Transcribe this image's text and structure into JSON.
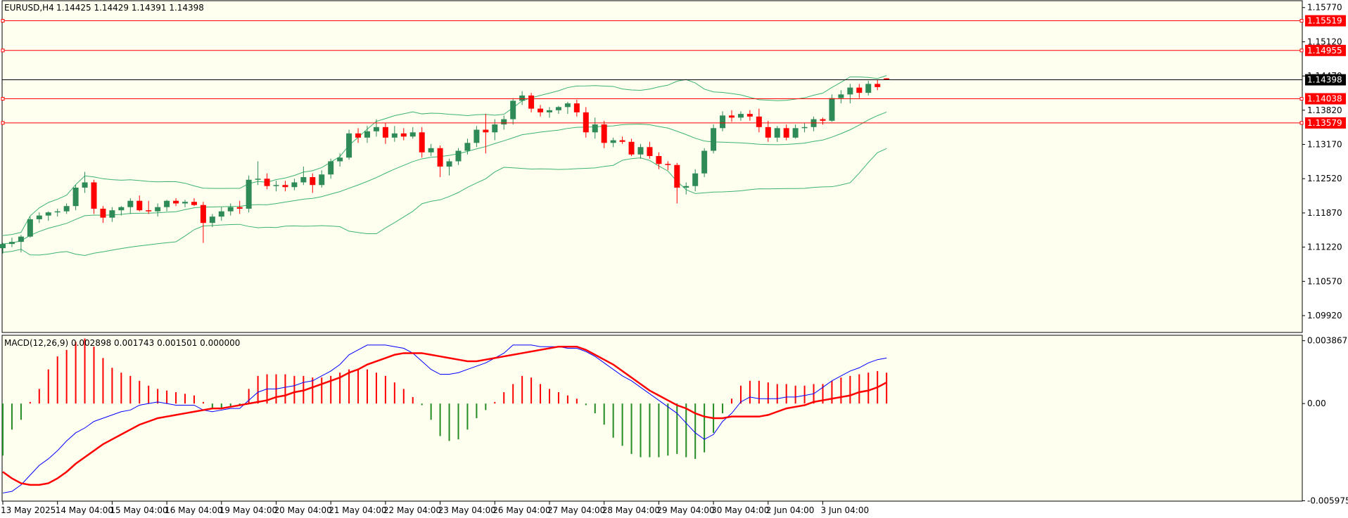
{
  "header": {
    "symbol": "EURUSD,H4",
    "ohlc": "1.14425 1.14429 1.14391 1.14398"
  },
  "macd_header": "MACD(12,26,9) 0.002898 0.001743 0.001501 0.000000",
  "colors": {
    "bg": "#fffff0",
    "bull": "#2e8b57",
    "bear": "#ff0000",
    "bands": "#3cb371",
    "macd": "#0000ff",
    "signal": "#ff0000",
    "level": "#ff0000",
    "bid": "#000000"
  },
  "chart_data": [
    {
      "type": "candlestick",
      "title": "EURUSD,H4",
      "ylim": [
        1.096,
        1.159
      ],
      "y_ticks": [
        "1.15770",
        "1.15120",
        "1.14470",
        "1.13820",
        "1.13170",
        "1.12520",
        "1.11870",
        "1.11220",
        "1.10570",
        "1.09920"
      ],
      "x_ticks": [
        "13 May 2025",
        "14 May 04:00",
        "15 May 04:00",
        "16 May 04:00",
        "19 May 04:00",
        "20 May 04:00",
        "21 May 04:00",
        "22 May 04:00",
        "23 May 04:00",
        "26 May 04:00",
        "27 May 04:00",
        "28 May 04:00",
        "29 May 04:00",
        "30 May 04:00",
        "2 Jun 04:00",
        "3 Jun 04:00"
      ],
      "price_labels": [
        {
          "text": "1.15519",
          "value": 1.15519,
          "style": "level"
        },
        {
          "text": "1.14955",
          "value": 1.14955,
          "style": "level"
        },
        {
          "text": "1.14398",
          "value": 1.14398,
          "style": "bid"
        },
        {
          "text": "1.14038",
          "value": 1.14038,
          "style": "level"
        },
        {
          "text": "1.13579",
          "value": 1.13579,
          "style": "level"
        }
      ],
      "ohlc": [
        [
          1.112,
          1.113,
          1.111,
          1.1128
        ],
        [
          1.1128,
          1.114,
          1.1122,
          1.1132
        ],
        [
          1.1132,
          1.1145,
          1.1112,
          1.1142
        ],
        [
          1.1142,
          1.118,
          1.114,
          1.1175
        ],
        [
          1.1175,
          1.1188,
          1.1168,
          1.1182
        ],
        [
          1.1182,
          1.119,
          1.1172,
          1.1188
        ],
        [
          1.1188,
          1.1195,
          1.118,
          1.119
        ],
        [
          1.119,
          1.1205,
          1.1185,
          1.12
        ],
        [
          1.12,
          1.124,
          1.1192,
          1.1235
        ],
        [
          1.1235,
          1.1265,
          1.1225,
          1.1245
        ],
        [
          1.1245,
          1.125,
          1.1185,
          1.1195
        ],
        [
          1.1195,
          1.12,
          1.1168,
          1.1178
        ],
        [
          1.1178,
          1.1198,
          1.117,
          1.1192
        ],
        [
          1.1192,
          1.12,
          1.1182,
          1.1198
        ],
        [
          1.1198,
          1.1215,
          1.1185,
          1.121
        ],
        [
          1.121,
          1.122,
          1.119,
          1.1192
        ],
        [
          1.1192,
          1.121,
          1.1185,
          1.119
        ],
        [
          1.119,
          1.1205,
          1.118,
          1.1198
        ],
        [
          1.1198,
          1.1212,
          1.119,
          1.121
        ],
        [
          1.121,
          1.1215,
          1.12,
          1.1205
        ],
        [
          1.1205,
          1.1212,
          1.1198,
          1.1208
        ],
        [
          1.1208,
          1.1215,
          1.12,
          1.1202
        ],
        [
          1.1202,
          1.1208,
          1.113,
          1.1168
        ],
        [
          1.1168,
          1.1185,
          1.116,
          1.118
        ],
        [
          1.118,
          1.1198,
          1.1172,
          1.119
        ],
        [
          1.119,
          1.1205,
          1.1182,
          1.1198
        ],
        [
          1.1198,
          1.121,
          1.1185,
          1.1195
        ],
        [
          1.1195,
          1.1258,
          1.1188,
          1.125
        ],
        [
          1.125,
          1.1285,
          1.124,
          1.1252
        ],
        [
          1.1252,
          1.1262,
          1.1232,
          1.1238
        ],
        [
          1.1238,
          1.1248,
          1.1228,
          1.124
        ],
        [
          1.124,
          1.1248,
          1.1228,
          1.1236
        ],
        [
          1.1236,
          1.1252,
          1.123,
          1.1245
        ],
        [
          1.1245,
          1.1275,
          1.124,
          1.1255
        ],
        [
          1.1255,
          1.1262,
          1.1225,
          1.124
        ],
        [
          1.124,
          1.1268,
          1.1235,
          1.126
        ],
        [
          1.126,
          1.129,
          1.1252,
          1.1285
        ],
        [
          1.1285,
          1.13,
          1.1275,
          1.1292
        ],
        [
          1.1292,
          1.1345,
          1.1288,
          1.1338
        ],
        [
          1.1338,
          1.1348,
          1.132,
          1.133
        ],
        [
          1.133,
          1.1352,
          1.132,
          1.1342
        ],
        [
          1.1342,
          1.1365,
          1.1332,
          1.135
        ],
        [
          1.135,
          1.1358,
          1.1318,
          1.133
        ],
        [
          1.133,
          1.1352,
          1.1322,
          1.1338
        ],
        [
          1.1338,
          1.1348,
          1.1325,
          1.1332
        ],
        [
          1.1332,
          1.135,
          1.1328,
          1.134
        ],
        [
          1.134,
          1.135,
          1.1292,
          1.1302
        ],
        [
          1.1302,
          1.1318,
          1.1295,
          1.131
        ],
        [
          1.131,
          1.1315,
          1.1255,
          1.1275
        ],
        [
          1.1275,
          1.129,
          1.1258,
          1.1285
        ],
        [
          1.1285,
          1.131,
          1.1278,
          1.1305
        ],
        [
          1.1305,
          1.1328,
          1.1298,
          1.132
        ],
        [
          1.132,
          1.1352,
          1.1312,
          1.1345
        ],
        [
          1.1345,
          1.1375,
          1.13,
          1.134
        ],
        [
          1.134,
          1.1365,
          1.1325,
          1.1355
        ],
        [
          1.1355,
          1.1372,
          1.1345,
          1.1365
        ],
        [
          1.1365,
          1.1405,
          1.1355,
          1.14
        ],
        [
          1.14,
          1.1418,
          1.1392,
          1.141
        ],
        [
          1.141,
          1.1415,
          1.1378,
          1.1385
        ],
        [
          1.1385,
          1.1392,
          1.137,
          1.1378
        ],
        [
          1.1378,
          1.1388,
          1.1368,
          1.1382
        ],
        [
          1.1382,
          1.139,
          1.1375,
          1.1388
        ],
        [
          1.1388,
          1.1398,
          1.1375,
          1.1395
        ],
        [
          1.1395,
          1.1402,
          1.137,
          1.1378
        ],
        [
          1.1378,
          1.1388,
          1.133,
          1.134
        ],
        [
          1.134,
          1.1368,
          1.1328,
          1.1355
        ],
        [
          1.1355,
          1.1362,
          1.131,
          1.132
        ],
        [
          1.132,
          1.133,
          1.1312,
          1.1325
        ],
        [
          1.1325,
          1.1332,
          1.1318,
          1.1322
        ],
        [
          1.1322,
          1.1328,
          1.1295,
          1.1298
        ],
        [
          1.1298,
          1.1318,
          1.129,
          1.1312
        ],
        [
          1.1312,
          1.1322,
          1.129,
          1.1295
        ],
        [
          1.1295,
          1.1302,
          1.127,
          1.128
        ],
        [
          1.128,
          1.1285,
          1.1268,
          1.1278
        ],
        [
          1.1278,
          1.1282,
          1.1205,
          1.1235
        ],
        [
          1.1235,
          1.1245,
          1.1222,
          1.1238
        ],
        [
          1.1238,
          1.127,
          1.1228,
          1.1262
        ],
        [
          1.1262,
          1.131,
          1.1255,
          1.1305
        ],
        [
          1.1305,
          1.1355,
          1.13,
          1.1348
        ],
        [
          1.1348,
          1.138,
          1.1342,
          1.1372
        ],
        [
          1.1372,
          1.1382,
          1.136,
          1.1368
        ],
        [
          1.1368,
          1.138,
          1.1362,
          1.1375
        ],
        [
          1.1375,
          1.1382,
          1.1362,
          1.137
        ],
        [
          1.137,
          1.1385,
          1.134,
          1.135
        ],
        [
          1.135,
          1.1362,
          1.1322,
          1.133
        ],
        [
          1.133,
          1.1352,
          1.1322,
          1.1348
        ],
        [
          1.1348,
          1.1355,
          1.1325,
          1.133
        ],
        [
          1.133,
          1.1355,
          1.1328,
          1.1348
        ],
        [
          1.1348,
          1.1358,
          1.134,
          1.135
        ],
        [
          1.135,
          1.137,
          1.1342,
          1.1365
        ],
        [
          1.1365,
          1.1368,
          1.1355,
          1.1362
        ],
        [
          1.1362,
          1.1412,
          1.136,
          1.1405
        ],
        [
          1.1405,
          1.142,
          1.1395,
          1.1412
        ],
        [
          1.1412,
          1.1432,
          1.1395,
          1.1425
        ],
        [
          1.1425,
          1.1432,
          1.1405,
          1.1415
        ],
        [
          1.1415,
          1.1438,
          1.141,
          1.1432
        ],
        [
          1.1432,
          1.144,
          1.142,
          1.1426
        ],
        [
          1.14425,
          1.14429,
          1.14391,
          1.14398
        ]
      ],
      "bollinger": {
        "period": 20,
        "upper_visible": "from start",
        "middle_visible": "from start",
        "lower_visible": "from start"
      }
    },
    {
      "type": "bar+line",
      "title": "MACD(12,26,9) 0.002898 0.001743 0.001501 0.000000",
      "ylim": [
        -0.006,
        0.0042
      ],
      "y_ticks": [
        "0.003867",
        "0.00",
        "-0.005975"
      ],
      "series": [
        {
          "name": "histogram",
          "values": [
            -0.0032,
            -0.0016,
            -0.001,
            0.0001,
            0.0009,
            0.0021,
            0.0029,
            0.0033,
            0.0038,
            0.004,
            0.0035,
            0.0028,
            0.0022,
            0.0019,
            0.0017,
            0.0014,
            0.0011,
            0.0009,
            0.0008,
            0.0007,
            0.0006,
            0.0005,
            0.0001,
            -0.0003,
            -0.0003,
            -0.0002,
            -0.0001,
            0.0009,
            0.0017,
            0.0018,
            0.0018,
            0.0018,
            0.0017,
            0.0017,
            0.0016,
            0.0016,
            0.0017,
            0.0019,
            0.0021,
            0.0021,
            0.0021,
            0.0019,
            0.0017,
            0.0013,
            0.0009,
            0.0004,
            -0.0001,
            -0.001,
            -0.002,
            -0.0023,
            -0.0022,
            -0.0016,
            -0.0009,
            -0.0004,
            0.0001,
            0.0007,
            0.0012,
            0.0017,
            0.0016,
            0.0012,
            0.0009,
            0.0007,
            0.0005,
            0.0003,
            -0.0001,
            -0.0006,
            -0.0013,
            -0.0021,
            -0.0026,
            -0.0031,
            -0.0033,
            -0.0033,
            -0.0033,
            -0.0032,
            -0.0031,
            -0.0033,
            -0.0034,
            -0.003,
            -0.0018,
            -0.0006,
            0.0003,
            0.0011,
            0.0014,
            0.0014,
            0.0013,
            0.0012,
            0.0012,
            0.0011,
            0.0011,
            0.0012,
            0.0012,
            0.0014,
            0.0016,
            0.0017,
            0.0018,
            0.0019,
            0.002,
            0.0019
          ]
        },
        {
          "name": "macd",
          "values": [
            -0.0055,
            -0.0054,
            -0.005,
            -0.0044,
            -0.0038,
            -0.0034,
            -0.0029,
            -0.0023,
            -0.0018,
            -0.0015,
            -0.0011,
            -0.0009,
            -0.0007,
            -0.0005,
            -0.0004,
            -0.0001,
            0.0,
            0.0001,
            0.0,
            -0.0001,
            -0.0001,
            -0.0001,
            -0.0004,
            -0.0005,
            -0.0004,
            -0.0003,
            -0.0003,
            0.0002,
            0.0007,
            0.0009,
            0.0009,
            0.001,
            0.0011,
            0.0013,
            0.0014,
            0.0017,
            0.002,
            0.0024,
            0.003,
            0.0033,
            0.0036,
            0.0036,
            0.0036,
            0.0035,
            0.0034,
            0.0031,
            0.0026,
            0.0021,
            0.0018,
            0.0018,
            0.0019,
            0.0021,
            0.0023,
            0.0025,
            0.0028,
            0.0031,
            0.0036,
            0.0036,
            0.0036,
            0.0035,
            0.0035,
            0.0035,
            0.0034,
            0.0034,
            0.0032,
            0.0029,
            0.0025,
            0.0021,
            0.0017,
            0.0014,
            0.001,
            0.0006,
            0.0002,
            -0.0002,
            -0.0006,
            -0.0012,
            -0.0018,
            -0.0022,
            -0.0019,
            -0.0011,
            -0.0006,
            0.0001,
            0.0004,
            0.0003,
            0.0003,
            0.0003,
            0.0004,
            0.0004,
            0.0005,
            0.0006,
            0.001,
            0.0014,
            0.0017,
            0.002,
            0.0022,
            0.0025,
            0.0027,
            0.0028
          ]
        },
        {
          "name": "signal",
          "values": [
            -0.0042,
            -0.0046,
            -0.0049,
            -0.005,
            -0.005,
            -0.0049,
            -0.0046,
            -0.0042,
            -0.0037,
            -0.0033,
            -0.0029,
            -0.0025,
            -0.0022,
            -0.0019,
            -0.0016,
            -0.0013,
            -0.0011,
            -0.0009,
            -0.0008,
            -0.0007,
            -0.0006,
            -0.0005,
            -0.0004,
            -0.0003,
            -0.0003,
            -0.0002,
            -0.0001,
            0.0,
            0.0001,
            0.0002,
            0.0004,
            0.0005,
            0.0007,
            0.0008,
            0.001,
            0.0012,
            0.0014,
            0.0016,
            0.0019,
            0.0021,
            0.0024,
            0.0026,
            0.0028,
            0.003,
            0.0031,
            0.0031,
            0.0031,
            0.003,
            0.0029,
            0.0028,
            0.0027,
            0.0026,
            0.0026,
            0.0027,
            0.0028,
            0.0029,
            0.003,
            0.0031,
            0.0032,
            0.0033,
            0.0034,
            0.0035,
            0.0035,
            0.0035,
            0.0033,
            0.003,
            0.0027,
            0.0024,
            0.002,
            0.0016,
            0.0012,
            0.0008,
            0.0005,
            0.0002,
            -0.0001,
            -0.0003,
            -0.0006,
            -0.0008,
            -0.0009,
            -0.0009,
            -0.0008,
            -0.0008,
            -0.0008,
            -0.0008,
            -0.0007,
            -0.0005,
            -0.0003,
            -0.0002,
            -0.0001,
            0.0001,
            0.0002,
            0.0003,
            0.0004,
            0.0005,
            0.0007,
            0.0008,
            0.001,
            0.0013
          ]
        }
      ]
    }
  ]
}
